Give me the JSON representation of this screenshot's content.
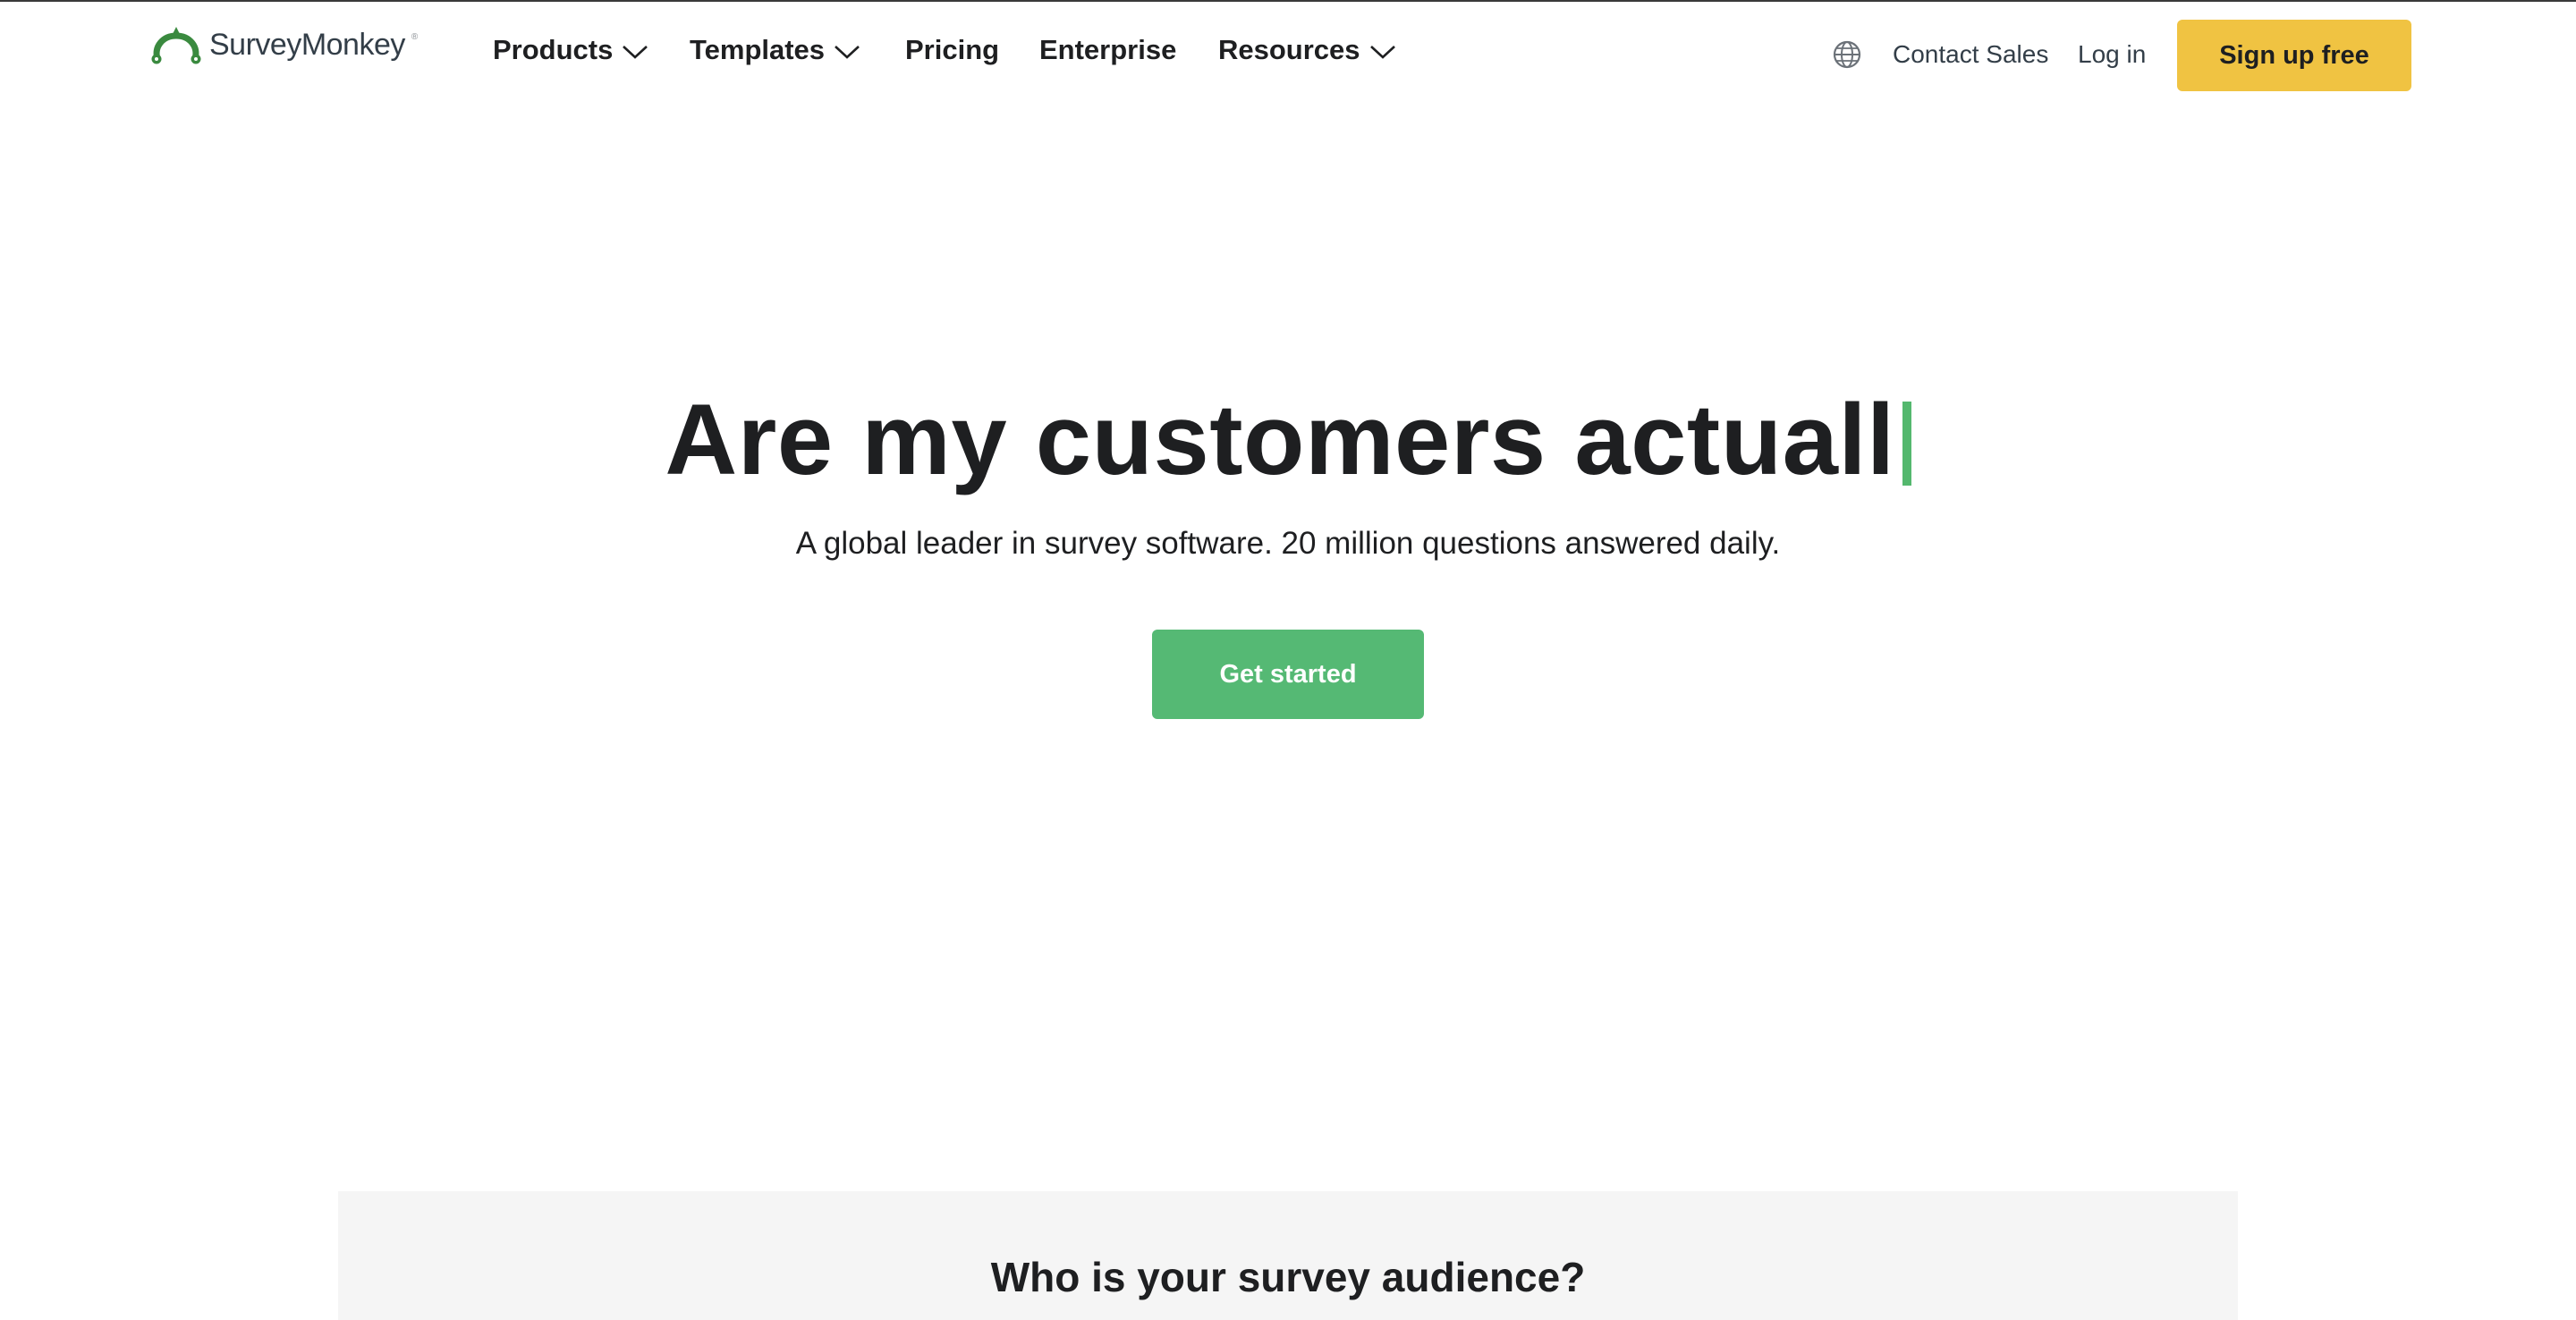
{
  "brand": {
    "name": "SurveyMonkey",
    "registered_mark": "®",
    "logo_icon": "surveymonkey-logo-icon",
    "logo_color": "#3a8a3f"
  },
  "nav": {
    "items": [
      {
        "label": "Products",
        "has_dropdown": true
      },
      {
        "label": "Templates",
        "has_dropdown": true
      },
      {
        "label": "Pricing",
        "has_dropdown": false
      },
      {
        "label": "Enterprise",
        "has_dropdown": false
      },
      {
        "label": "Resources",
        "has_dropdown": true
      }
    ],
    "dropdown_icon": "chevron-down-icon"
  },
  "header_actions": {
    "language_icon": "globe-icon",
    "contact_sales": "Contact Sales",
    "login": "Log in",
    "signup": "Sign up free"
  },
  "hero": {
    "title_typed": "Are my customers actuall",
    "subtitle": "A global leader in survey software. 20 million questions answered daily.",
    "cta": "Get started"
  },
  "audience": {
    "title": "Who is your survey audience?"
  },
  "colors": {
    "signup_bg": "#f0c342",
    "cta_bg": "#55b974",
    "cursor": "#54b86e",
    "text": "#1e1f21",
    "section_bg": "#f5f5f5"
  }
}
